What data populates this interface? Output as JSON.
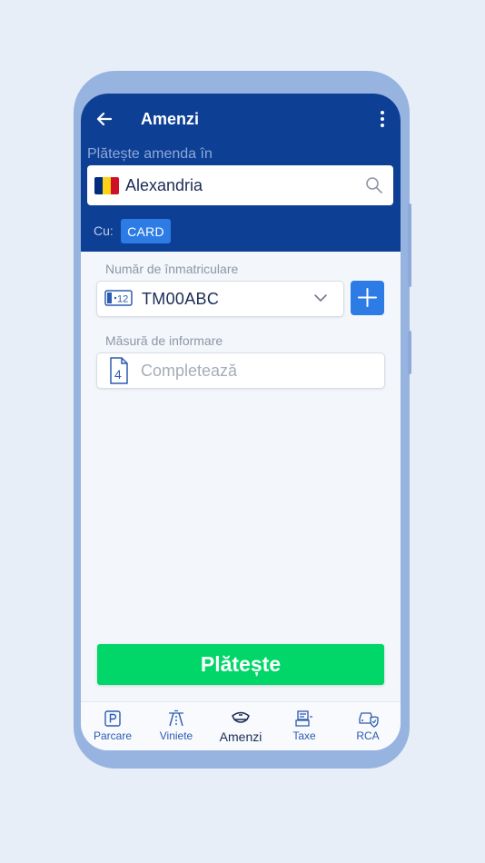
{
  "header": {
    "title": "Amenzi",
    "pay_in_label": "Plătește amenda în",
    "city": "Alexandria",
    "pay_with_label": "Cu:",
    "payment_method": "CARD"
  },
  "form": {
    "plate_label": "Număr de înmatriculare",
    "plate_value": "TM00ABC",
    "info_label": "Măsură de informare",
    "info_placeholder": "Completează",
    "pay_button": "Plătește"
  },
  "bottom_nav": {
    "items": [
      {
        "label": "Parcare",
        "icon": "parking-icon"
      },
      {
        "label": "Viniete",
        "icon": "road-icon"
      },
      {
        "label": "Amenzi",
        "icon": "police-cap-icon",
        "active": true
      },
      {
        "label": "Taxe",
        "icon": "tax-icon"
      },
      {
        "label": "RCA",
        "icon": "car-shield-icon"
      }
    ]
  },
  "colors": {
    "header_bg": "#0d3f95",
    "accent_blue": "#2d7be5",
    "pay_green": "#00d768",
    "flag": [
      "#002b7f",
      "#fcd116",
      "#ce1126"
    ]
  }
}
